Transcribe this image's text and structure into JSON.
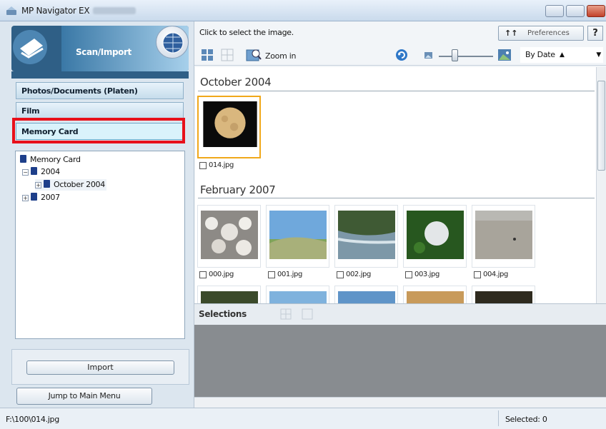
{
  "window": {
    "title": "MP Navigator EX"
  },
  "left": {
    "header_label": "Scan/Import",
    "modes": [
      {
        "label": "Photos/Documents (Platen)"
      },
      {
        "label": "Film"
      },
      {
        "label": "Memory Card"
      }
    ],
    "tree": [
      {
        "label": "Memory Card"
      },
      {
        "label": "2004"
      },
      {
        "label": "October 2004"
      },
      {
        "label": "2007"
      }
    ],
    "import_label": "Import",
    "jump_label": "Jump to Main Menu"
  },
  "right": {
    "hint": "Click to select the image.",
    "preferences_label": "Preferences",
    "help_label": "?",
    "zoom_label": "Zoom in",
    "sort_value": "By Date",
    "groups": [
      {
        "title": "October 2004",
        "items": [
          {
            "name": "014.jpg"
          }
        ]
      },
      {
        "title": "February 2007",
        "items": [
          {
            "name": "000.jpg"
          },
          {
            "name": "001.jpg"
          },
          {
            "name": "002.jpg"
          },
          {
            "name": "003.jpg"
          },
          {
            "name": "004.jpg"
          }
        ]
      }
    ],
    "selections_label": "Selections"
  },
  "status": {
    "path": "F:\\100\\014.jpg",
    "selected": "Selected: 0"
  }
}
